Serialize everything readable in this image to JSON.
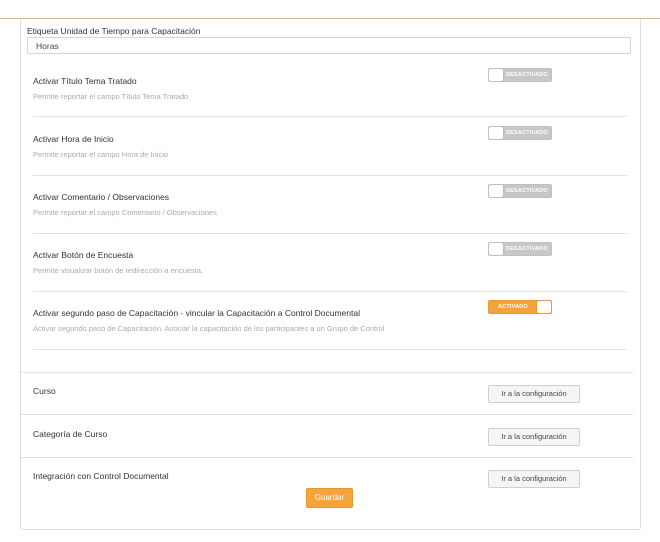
{
  "unit_label": {
    "label": "Etiqueta Unidad de Tiempo para Capacitación",
    "value": "Horas"
  },
  "settings": [
    {
      "title": "Activar Título Tema Tratado",
      "description": "Permite reportar el campo Título Tema Tratado",
      "state": "DESACTIVADO"
    },
    {
      "title": "Activar Hora de Inicio",
      "description": "Permite reportar el campo Hora de Inicio",
      "state": "DESACTIVADO"
    },
    {
      "title": "Activar Comentario / Observaciones",
      "description": "Permite reportar el campo Comentario / Observaciones",
      "state": "DESACTIVADO"
    },
    {
      "title": "Activar Botón de Encuesta",
      "description": "Permite visualizar botón de redirección a encuesta.",
      "state": "DESACTIVADO"
    },
    {
      "title": "Activar segundo paso de Capacitación - vincular la Capacitación a Control Documental",
      "description": "Activar segundo paso de Capacitación. Asociar la capacitación de los participantes a un Grupo de Control",
      "state": "ACTIVADO"
    }
  ],
  "config": [
    {
      "label": "Curso",
      "button": "Ir a la configuración"
    },
    {
      "label": "Categoría de Curso",
      "button": "Ir a la configuración"
    },
    {
      "label": "Integración con Control Documental",
      "button": "Ir a la configuración"
    }
  ],
  "save_label": "Guardar",
  "colors": {
    "accent": "#f5a43a",
    "toggle_off": "#c7c7c7"
  }
}
